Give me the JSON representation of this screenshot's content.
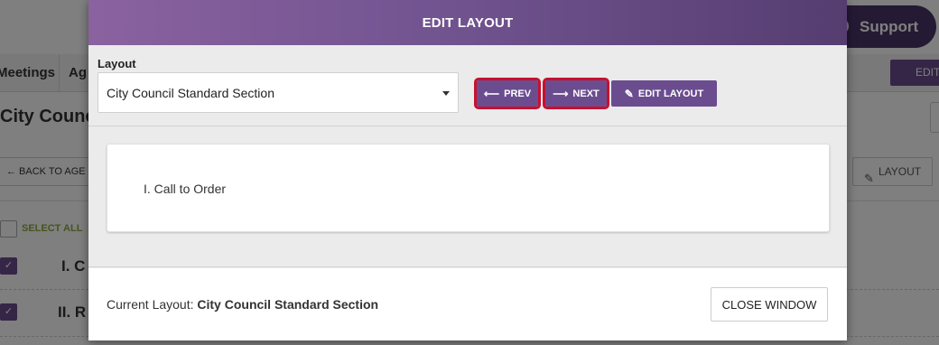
{
  "background": {
    "support_label": "Support",
    "tabs": [
      "Meetings",
      "Ag"
    ],
    "edit_button_label": "EDIT",
    "page_title": "City Counc",
    "back_button_label": "← BACK TO AGE",
    "layout_button_label": "LAYOUT",
    "select_all_label": "SELECT ALL",
    "rows": [
      "I. C",
      "II. R"
    ]
  },
  "modal": {
    "title": "EDIT LAYOUT",
    "layout_label": "Layout",
    "layout_select_value": "City Council Standard Section",
    "buttons": {
      "prev": "PREV",
      "next": "NEXT",
      "edit_layout": "EDIT LAYOUT"
    },
    "icons": {
      "prev": "arrow-left-icon",
      "next": "arrow-right-icon",
      "edit_layout": "pencil-icon"
    },
    "preview_items": [
      "I. Call to Order"
    ],
    "footer": {
      "current_layout_label": "Current Layout:",
      "current_layout_value": "City Council Standard Section",
      "close_button": "CLOSE WINDOW"
    }
  },
  "colors": {
    "accent": "#6b4d8f",
    "highlight_outline": "#c8102e",
    "select_all": "#8aa93d"
  }
}
